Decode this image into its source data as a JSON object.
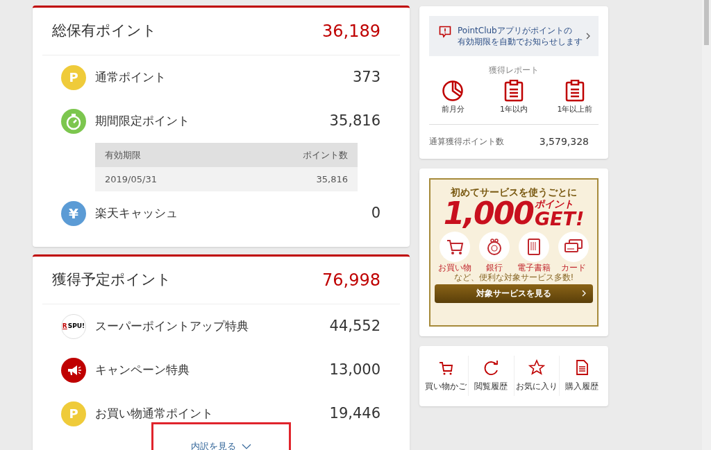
{
  "held_points": {
    "title": "総保有ポイント",
    "total": "36,189",
    "items": [
      {
        "kind": "regular",
        "icon_text": "P",
        "label": "通常ポイント",
        "value": "373"
      },
      {
        "kind": "limited",
        "label": "期間限定ポイント",
        "value": "35,816",
        "expiry_table": {
          "columns": [
            "有効期限",
            "ポイント数"
          ],
          "rows": [
            [
              "2019/05/31",
              "35,816"
            ]
          ]
        }
      },
      {
        "kind": "cash",
        "icon_text": "¥",
        "label": "楽天キャッシュ",
        "value": "0"
      }
    ]
  },
  "pending_points": {
    "title": "獲得予定ポイント",
    "total": "76,998",
    "items": [
      {
        "kind": "spu",
        "logo_mark": "R",
        "logo_text": "SPU!",
        "label": "スーパーポイントアップ特典",
        "value": "44,552"
      },
      {
        "kind": "campaign",
        "label": "キャンペーン特典",
        "value": "13,000"
      },
      {
        "kind": "regular",
        "icon_text": "P",
        "label": "お買い物通常ポイント",
        "value": "19,446"
      }
    ],
    "breakdown_link": "内訳を見る"
  },
  "notice": {
    "lines": [
      "PointClubアプリがポイントの",
      "有効期限を自動でお知らせします"
    ]
  },
  "report": {
    "title": "獲得レポート",
    "items": [
      {
        "kind": "pie",
        "label": "前月分"
      },
      {
        "kind": "clipboard",
        "label": "1年以内"
      },
      {
        "kind": "clipboard",
        "label": "1年以上前"
      }
    ]
  },
  "lifetime": {
    "label": "通算獲得ポイント数",
    "value": "3,579,328"
  },
  "banner": {
    "headline": "初めてサービスを使うごとに",
    "amount": "1,000",
    "unit": "ポイント",
    "get": "GET!",
    "services": [
      {
        "kind": "cart",
        "label": "お買い物"
      },
      {
        "kind": "purse",
        "label": "銀行"
      },
      {
        "kind": "ebook",
        "label": "電子書籍"
      },
      {
        "kind": "card",
        "label": "カード"
      }
    ],
    "note": "など、便利な対象サービス多数!",
    "button": "対象サービスを見る"
  },
  "shortcuts": [
    {
      "kind": "cart",
      "label": "買い物かご"
    },
    {
      "kind": "history",
      "label": "閲覧履歴"
    },
    {
      "kind": "star",
      "label": "お気に入り"
    },
    {
      "kind": "document",
      "label": "購入履歴"
    }
  ]
}
